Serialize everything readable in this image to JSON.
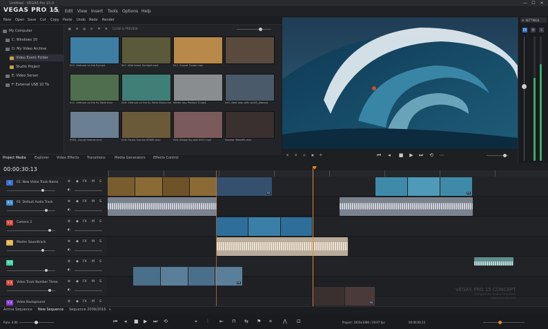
{
  "window": {
    "title": "Untitled - VEGAS Pro 15.0",
    "buttons": [
      "—",
      "☐",
      "✕"
    ]
  },
  "brand": {
    "logo": "VEGAS PRO 15"
  },
  "menu": [
    "File",
    "Edit",
    "View",
    "Insert",
    "Tools",
    "Options",
    "Help"
  ],
  "toolbar": [
    "New",
    "Open",
    "Save",
    "Cut",
    "Copy",
    "Paste",
    "Undo",
    "Redo",
    "Render"
  ],
  "tree": {
    "items": [
      "My Computer",
      "C: Windows 10",
      "D: My Video Archive",
      "Video Event Folder",
      "Studio Project",
      "E: Video Server",
      "F: External USB 10 Tb"
    ]
  },
  "browser": {
    "zoom_label": "CLOSE & PREVIEW",
    "thumbs": [
      {
        "caption": "022- Vietnam on the fly.mp4",
        "color": "#3f7ea3"
      },
      {
        "caption": "007- Wild forest Sunlight.mp4",
        "color": "#5a5a3a"
      },
      {
        "caption": "017- Sunset Ocean.mov",
        "color": "#b9894a"
      },
      {
        "caption": "",
        "color": "#5a4a3e"
      },
      {
        "caption": "012- Vietnam on the fly Table.mov",
        "color": "#4f6e4e"
      },
      {
        "caption": "026- Vietnam on the fly Table-Stock.mov",
        "color": "#3f7f77"
      },
      {
        "caption": "Winter day Product Tr.mp4",
        "color": "#8a8d90"
      },
      {
        "caption": "045- Next step with ALIVE_(Nexus)",
        "color": "#4a5a6a"
      },
      {
        "caption": "9983- Cloudy Islands.mov",
        "color": "#6b7f93"
      },
      {
        "caption": "026- Forest Sunrise 6580K.mov",
        "color": "#6a5a3a"
      },
      {
        "caption": "026- Bridge Bg shot 0907.mp4",
        "color": "#7a5a5a"
      },
      {
        "caption": "Nuclear Takeoffs.mov",
        "color": "#3a3030"
      }
    ]
  },
  "preview": {
    "settings_label": "SETTINGS"
  },
  "tabs": [
    "Project Media",
    "Explorer",
    "Video Effects",
    "Transitions",
    "Media Generators",
    "Effects Control"
  ],
  "timeline": {
    "timecode": "00:00:30:13",
    "tracks": [
      {
        "num": "1",
        "name": "01: New Video Track Name",
        "color": "#3b6fd4",
        "type": "video",
        "fx": "FX"
      },
      {
        "num": "A 1",
        "name": "01: Default Audio Track",
        "color": "#3b8fd4",
        "type": "audio",
        "fx": "FX"
      },
      {
        "num": "V 2",
        "name": "Camera 3",
        "color": "#d44a3b",
        "type": "video",
        "fx": "FX"
      },
      {
        "num": "A 2",
        "name": "Master Soundtrack",
        "color": "#e0b24a",
        "type": "audio",
        "fx": "FX"
      },
      {
        "num": "A 3",
        "name": "",
        "color": "#3bd4a3",
        "type": "audio",
        "fx": "FX"
      },
      {
        "num": "V 3",
        "name": "Video Track Number Three",
        "color": "#d44a3b",
        "type": "video",
        "fx": "FX"
      },
      {
        "num": "V 4",
        "name": "Video Background",
        "color": "#8a3bd4",
        "type": "video",
        "fx": "FX"
      }
    ],
    "clip_fx": "FX"
  },
  "sequences": [
    "Active Sequence",
    "New Sequence",
    "Sequence 2009/2016",
    "+"
  ],
  "status": {
    "rate": "Rate: 0.00",
    "record_label": "Project: 1920x1080 / 29.97 fps",
    "time_label": "00:00:00;15"
  },
  "watermark": {
    "line1": "VEGAS PRO 15 CONCEPT",
    "line2": "Designed by Andrei Chernikov",
    "line3": "vegasconcept.com"
  }
}
